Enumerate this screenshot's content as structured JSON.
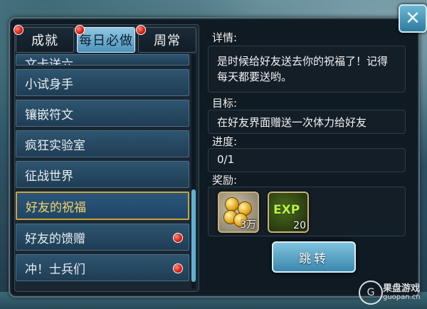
{
  "tabs": [
    {
      "label": "成就",
      "badge": true
    },
    {
      "label": "每日必做",
      "badge": true,
      "active": true
    },
    {
      "label": "周常",
      "badge": true
    }
  ],
  "list": {
    "items": [
      {
        "label": "文卡送六",
        "cut": true
      },
      {
        "label": "小试身手"
      },
      {
        "label": "镶嵌符文"
      },
      {
        "label": "疯狂实验室"
      },
      {
        "label": "征战世界"
      },
      {
        "label": "好友的祝福",
        "active": true
      },
      {
        "label": "好友的馈赠",
        "badge": true
      },
      {
        "label": "冲！士兵们",
        "badge": true
      }
    ]
  },
  "detail": {
    "details_label": "详情:",
    "details_text": "是时候给好友送去你的祝福了！记得每天都要送哟。",
    "target_label": "目标:",
    "target_text": "在好友界面赠送一次体力给好友",
    "progress_label": "进度:",
    "progress_text": "0/1",
    "reward_label": "奖励:",
    "rewards": [
      {
        "icon": "gold-coins-icon",
        "count": "3万"
      },
      {
        "icon": "exp-icon",
        "label": "EXP",
        "count": "20"
      }
    ],
    "jump_label": "跳转"
  },
  "watermark": {
    "name": "果盘游戏",
    "url": "guopan.cn"
  },
  "colors": {
    "accent": "#4e93bb",
    "active_border": "#c9a43a",
    "active_text": "#f8d56a",
    "badge": "#d21c12"
  }
}
